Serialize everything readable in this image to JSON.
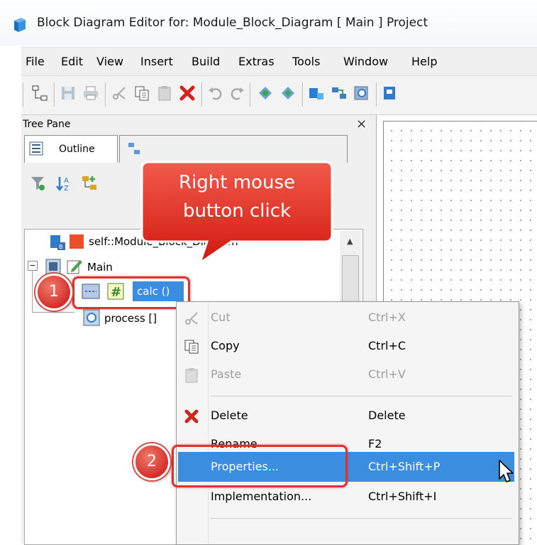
{
  "window": {
    "title": "Block Diagram Editor for: Module_Block_Diagram [ Main ] Project",
    "accent_color": "#3b8de0"
  },
  "menu": [
    "File",
    "Edit",
    "View",
    "Insert",
    "Build",
    "Extras",
    "Tools",
    "Window",
    "Help"
  ],
  "tree_pane": {
    "title": "Tree Pane",
    "close_glyph": "×",
    "tabs": [
      {
        "label": "Outline"
      }
    ],
    "items": [
      {
        "label": "self::Module_Block_Diagram",
        "icon": "module-block-icon"
      },
      {
        "label": "Main",
        "icon": "main-edit-icon",
        "expander": "−"
      },
      {
        "label": "calc ()",
        "icon": "calc-function-icon",
        "selected": true
      },
      {
        "label": "process []",
        "icon": "process-icon"
      }
    ]
  },
  "callout": {
    "text_line1": "Right mouse",
    "text_line2": "button click",
    "color": "#e2281f"
  },
  "badges": [
    "1",
    "2"
  ],
  "context_menu": {
    "items": [
      {
        "label": "Cut",
        "shortcut": "Ctrl+X",
        "enabled": false,
        "icon": "scissors-icon"
      },
      {
        "label": "Copy",
        "shortcut": "Ctrl+C",
        "enabled": true,
        "icon": "copy-icon"
      },
      {
        "label": "Paste",
        "shortcut": "Ctrl+V",
        "enabled": false,
        "icon": "paste-icon"
      },
      {
        "label": "Delete",
        "shortcut": "Delete",
        "enabled": true,
        "icon": "delete-x-icon"
      },
      {
        "label": "Rename",
        "shortcut": "F2",
        "enabled": true
      },
      {
        "label": "Properties...",
        "shortcut": "Ctrl+Shift+P",
        "enabled": true,
        "highlighted": true
      },
      {
        "label": "Implementation...",
        "shortcut": "Ctrl+Shift+I",
        "enabled": true
      }
    ]
  }
}
